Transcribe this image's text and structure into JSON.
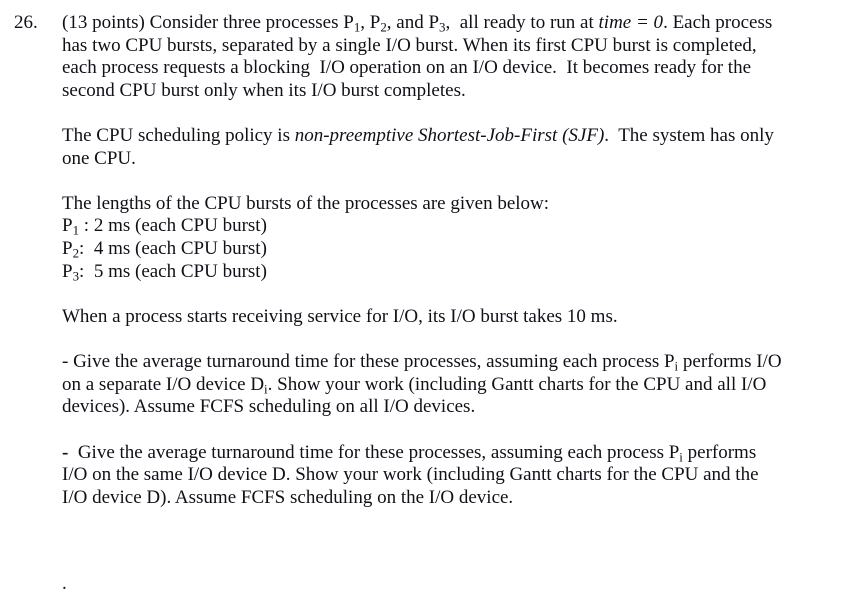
{
  "document": {
    "question_number": "26.",
    "points_label": "(13 points)",
    "paragraphs": {
      "intro_line1_pre": "(13 points) Consider three processes P",
      "intro": {
        "seg1": "(13 points) Consider three processes P",
        "sub1": "1",
        "seg2": ", P",
        "sub2": "2",
        "seg3": ", and P",
        "sub3": "3",
        "seg4": ",  all ready to run at ",
        "italic": "time = 0",
        "seg5": ". Each process has two CPU bursts, separated by a single I/O burst. When its first CPU burst is completed, each process requests a blocking  I/O operation on an I/O device.  It becomes ready for the second CPU burst only when its I/O burst completes."
      },
      "policy": {
        "seg1": "The CPU scheduling policy is ",
        "italic": "non-preemptive Shortest-Job-First (SJF)",
        "seg2": ".  The system has only one CPU."
      },
      "lengths_intro": "The lengths of the CPU bursts of the processes are given below:",
      "io_burst": "When a process starts receiving service for I/O, its I/O burst takes 10 ms.",
      "part_a": {
        "dash": "-",
        "seg1": " Give the average turnaround time for these processes, assuming each process P",
        "sub1": "i",
        "seg2": " performs I/O on a separate I/O device D",
        "sub2": "i",
        "seg3": ". Show your work (including Gantt charts for the CPU and all I/O devices). Assume FCFS scheduling on all I/O devices."
      },
      "part_b": {
        "dash": "-",
        "seg1": "  Give the average turnaround time for these processes, assuming each process P",
        "sub1": "i",
        "seg2": " performs I/O on the same I/O device D. Show your work (including Gantt charts for the CPU and the I/O device D). Assume FCFS scheduling on the I/O device."
      },
      "trailing_period": "."
    },
    "burst_table": [
      {
        "process": "P",
        "subscript": "1",
        "separator": " : ",
        "value": "2 ms (each CPU burst)"
      },
      {
        "process": "P",
        "subscript": "2",
        "separator": ":  ",
        "value": "4 ms (each CPU burst)"
      },
      {
        "process": "P",
        "subscript": "3",
        "separator": ":  ",
        "value": "5 ms (each CPU burst)"
      }
    ],
    "colors": {
      "background": "#ffffff",
      "text": "#101018"
    }
  }
}
